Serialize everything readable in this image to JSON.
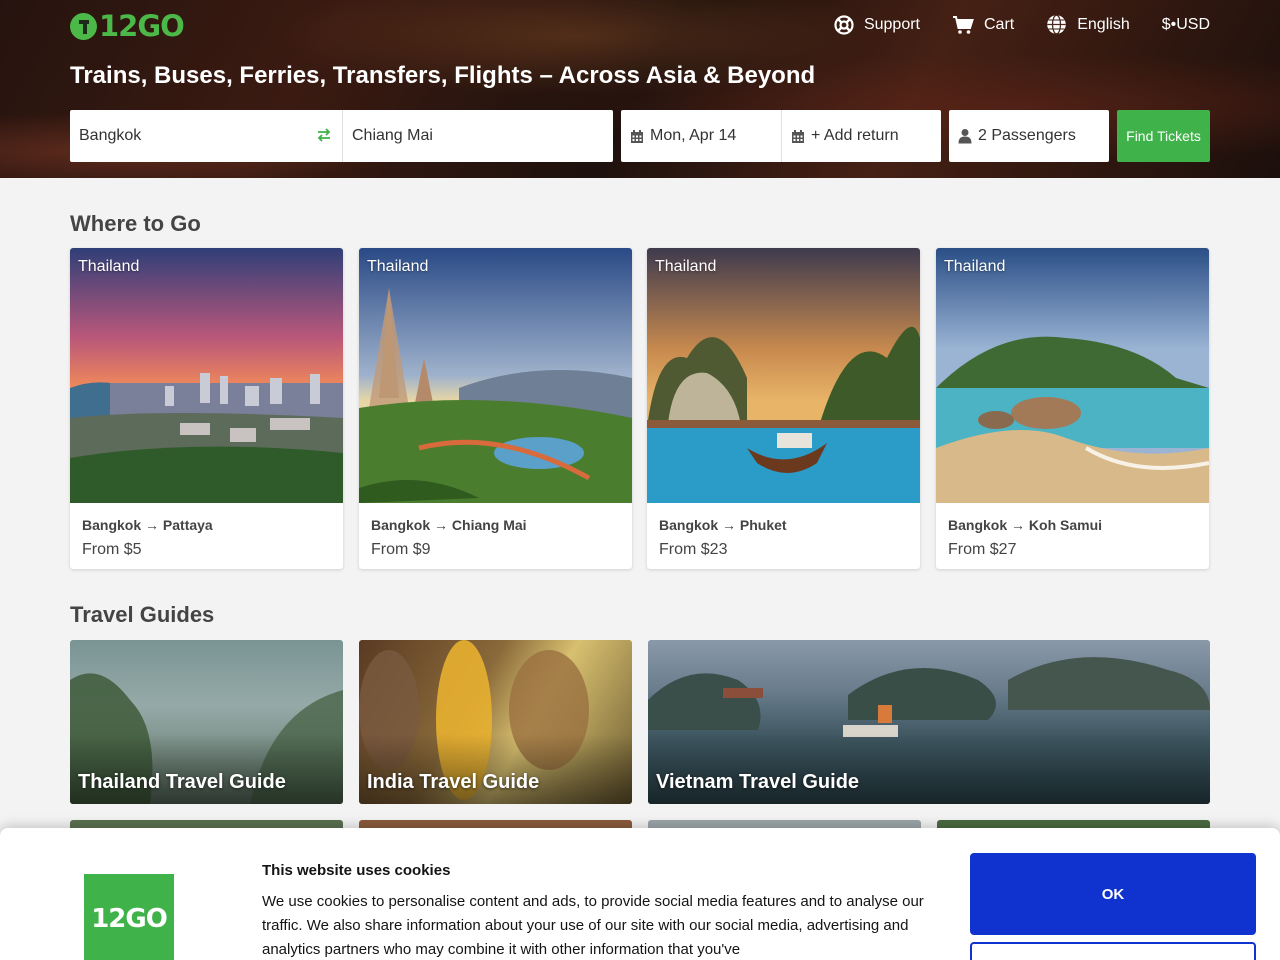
{
  "brand": {
    "logo_text": "12GO",
    "accent": "#4cb848",
    "button_green": "#3fb34a"
  },
  "topnav": {
    "support": "Support",
    "cart": "Cart",
    "language": "English",
    "currency": "$•USD"
  },
  "headline": "Trains, Buses, Ferries, Transfers, Flights – Across Asia & Beyond",
  "search": {
    "from": "Bangkok",
    "to": "Chiang Mai",
    "date": "Mon, Apr 14",
    "return": "+ Add return",
    "passengers": "2 Passengers",
    "button": "Find Tickets"
  },
  "where_to_go": {
    "title": "Where to Go",
    "cards": [
      {
        "country": "Thailand",
        "route": "Bangkok → Pattaya",
        "price": "From $5"
      },
      {
        "country": "Thailand",
        "route": "Bangkok → Chiang Mai",
        "price": "From $9"
      },
      {
        "country": "Thailand",
        "route": "Bangkok → Phuket",
        "price": "From $23"
      },
      {
        "country": "Thailand",
        "route": "Bangkok → Koh Samui",
        "price": "From $27"
      }
    ]
  },
  "travel_guides": {
    "title": "Travel Guides",
    "items": [
      {
        "label": "Thailand Travel Guide"
      },
      {
        "label": "India Travel Guide"
      },
      {
        "label": "Vietnam Travel Guide"
      }
    ]
  },
  "cookie": {
    "logo_text": "12GO",
    "title": "This website uses cookies",
    "text": "We use cookies to personalise content and ads, to provide social media features and to analyse our traffic. We also share information about your use of our site with our social media, advertising and analytics partners who may combine it with other information that you've",
    "ok": "OK",
    "ok_color": "#1032cf"
  }
}
